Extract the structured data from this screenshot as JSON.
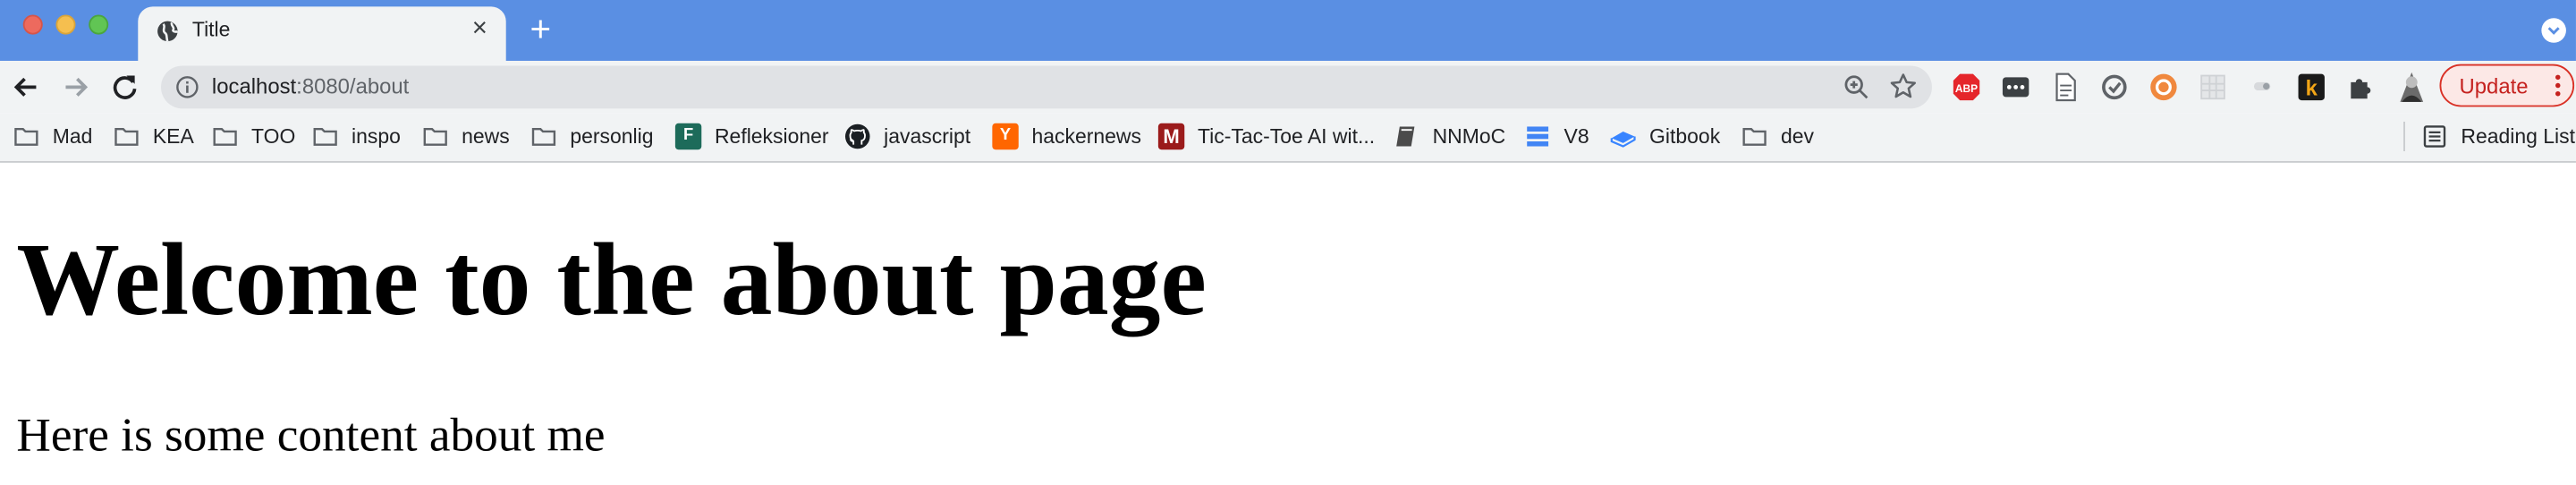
{
  "window": {
    "tab_title": "Title",
    "new_tab_label": "+"
  },
  "toolbar": {
    "url_host": "localhost",
    "url_path": ":8080/about",
    "update_label": "Update"
  },
  "bookmarks": [
    {
      "label": "Mad",
      "icon": "folder-icon"
    },
    {
      "label": "KEA",
      "icon": "folder-icon"
    },
    {
      "label": "TOO",
      "icon": "folder-icon"
    },
    {
      "label": "inspo",
      "icon": "folder-icon"
    },
    {
      "label": "news",
      "icon": "folder-icon"
    },
    {
      "label": "personlig",
      "icon": "folder-icon"
    },
    {
      "label": "Refleksioner",
      "icon": "forms-icon"
    },
    {
      "label": "javascript",
      "icon": "github-icon"
    },
    {
      "label": "hackernews",
      "icon": "ycombinator-icon"
    },
    {
      "label": "Tic-Tac-Toe AI wit...",
      "icon": "medium-icon"
    },
    {
      "label": "NNMoC",
      "icon": "book-icon"
    },
    {
      "label": "V8",
      "icon": "v8-icon"
    },
    {
      "label": "Gitbook",
      "icon": "gitbook-icon"
    },
    {
      "label": "dev",
      "icon": "folder-icon"
    }
  ],
  "reading_list": {
    "label": "Reading List"
  },
  "page": {
    "heading": "Welcome to the about page",
    "paragraph": "Here is some content about me"
  },
  "colors": {
    "tab_strip": "#5a8fe3",
    "toolbar": "#f1f3f4",
    "update_accent": "#d93025"
  }
}
